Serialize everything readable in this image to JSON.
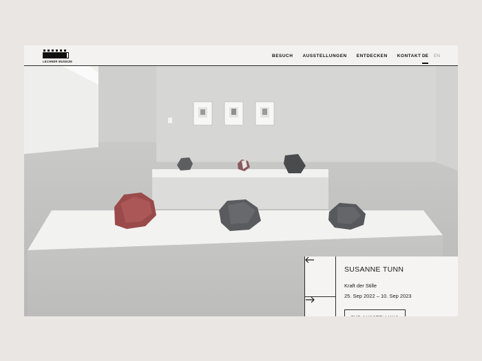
{
  "header": {
    "logo_text": "LECHNER MUSEUM",
    "nav": [
      "BESUCH",
      "AUSSTELLUNGEN",
      "ENTDECKEN",
      "KONTAKT"
    ],
    "languages": {
      "active": "DE",
      "inactive": "EN"
    }
  },
  "exhibition": {
    "artist": "SUSANNE TUNN",
    "title": "Kraft der Stille",
    "dates": "25. Sep 2022 – 10. Sep 2023",
    "cta_label": "ZUR AUSSTELLUNG"
  },
  "icons": {
    "prev": "arrow-left-icon",
    "next": "arrow-right-icon"
  }
}
